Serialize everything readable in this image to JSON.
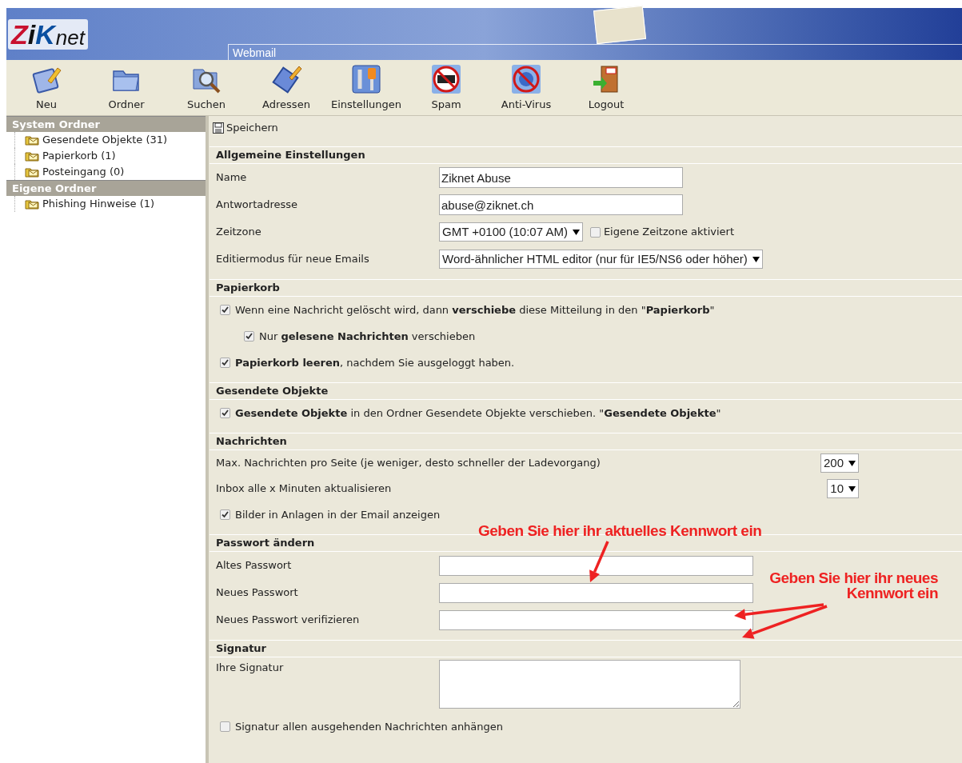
{
  "header": {
    "logo": [
      {
        "text": "Z"
      },
      {
        "text": "i"
      },
      {
        "text": "K"
      },
      {
        "text": "net"
      }
    ],
    "tab": "Webmail"
  },
  "toolbar": [
    {
      "label": "Neu",
      "kind": "compose"
    },
    {
      "label": "Ordner",
      "kind": "folder"
    },
    {
      "label": "Suchen",
      "kind": "search"
    },
    {
      "label": "Adressen",
      "kind": "addressbook"
    },
    {
      "label": "Einstellungen",
      "kind": "tools"
    },
    {
      "label": "Spam",
      "kind": "spam"
    },
    {
      "label": "Anti-Virus",
      "kind": "virus"
    },
    {
      "label": "Logout",
      "kind": "exit"
    }
  ],
  "sidebar": [
    {
      "title": "System Ordner",
      "items": [
        {
          "label": "Gesendete Objekte (31)"
        },
        {
          "label": "Papierkorb (1)"
        },
        {
          "label": "Posteingang (0)"
        }
      ]
    },
    {
      "title": "Eigene Ordner",
      "items": [
        {
          "label": "Phishing Hinweise (1)"
        }
      ]
    }
  ],
  "save_button": "Speichern",
  "sections": [
    {
      "title": "Allgemeine Einstellungen",
      "rows": [
        {
          "kind": "text",
          "label": "Name",
          "value": "Ziknet Abuse"
        },
        {
          "kind": "text",
          "label": "Antwortadresse",
          "value": "abuse@ziknet.ch"
        },
        {
          "kind": "select",
          "label": "Zeitzone",
          "value": "GMT +0100 (10:07 AM)",
          "checkbox": {
            "label": "Eigene Zeitzone aktiviert",
            "checked": false
          }
        },
        {
          "kind": "select",
          "label": "Editiermodus für neue Emails",
          "value": "Word-ähnlicher HTML editor (nur für IE5/NS6 oder höher)"
        }
      ]
    },
    {
      "title": "Papierkorb",
      "rows": [
        {
          "kind": "check",
          "text": "Wenn eine Nachricht gelöscht wird, dann **verschiebe** diese Mitteilung in den \"**Papierkorb**\"",
          "checked": true,
          "children": [
            {
              "kind": "check",
              "text": "Nur **gelesene Nachrichten** verschieben",
              "checked": true
            }
          ]
        },
        {
          "kind": "check",
          "text": "**Papierkorb leeren**, nachdem Sie ausgeloggt haben.",
          "checked": true
        }
      ]
    },
    {
      "title": "Gesendete Objekte",
      "rows": [
        {
          "kind": "check",
          "text": "**Gesendete Objekte** in den Ordner Gesendete Objekte verschieben. \"**Gesendete Objekte**\"",
          "checked": true
        }
      ]
    },
    {
      "title": "Nachrichten",
      "rows": [
        {
          "kind": "select_right",
          "label": "Max. Nachrichten pro Seite (je weniger, desto schneller der Ladevorgang)",
          "value": "200"
        },
        {
          "kind": "select_right",
          "label": "Inbox alle x Minuten aktualisieren",
          "value": "10"
        },
        {
          "kind": "check",
          "text": "Bilder in Anlagen in der Email anzeigen",
          "checked": true
        }
      ]
    },
    {
      "title": "Passwort ändern",
      "rows": [
        {
          "kind": "password",
          "label": "Altes Passwort"
        },
        {
          "kind": "password",
          "label": "Neues Passwort"
        },
        {
          "kind": "password",
          "label": "Neues Passwort verifizieren"
        }
      ]
    },
    {
      "title": "Signatur",
      "rows": [
        {
          "kind": "textarea",
          "label": "Ihre Signatur"
        },
        {
          "kind": "check",
          "text": "Signatur allen ausgehenden Nachrichten anhängen",
          "checked": false
        }
      ]
    }
  ],
  "annotations": [
    {
      "text": "Geben Sie hier ihr aktuelles Kennwort ein"
    },
    {
      "text": "Geben Sie hier ihr neues Kennwort ein"
    }
  ]
}
